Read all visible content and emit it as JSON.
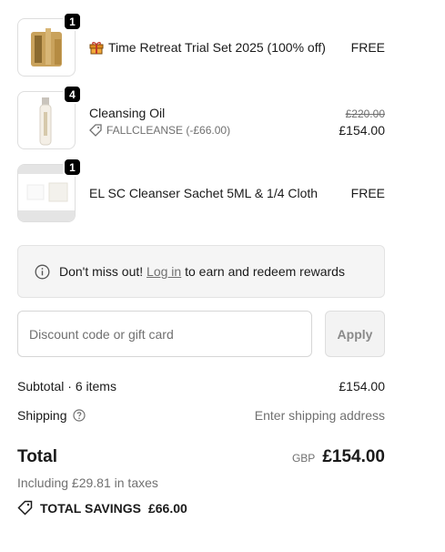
{
  "items": [
    {
      "qty": "1",
      "title": "Time Retreat Trial Set 2025 (100% off)",
      "price": "FREE",
      "icon": "gift-icon"
    },
    {
      "qty": "4",
      "title": "Cleansing Oil",
      "discount_code": "FALLCLEANSE (-£66.00)",
      "original_price": "£220.00",
      "price": "£154.00"
    },
    {
      "qty": "1",
      "title": "EL SC Cleanser Sachet 5ML & 1/4 Cloth",
      "price": "FREE"
    }
  ],
  "notice": {
    "prefix": "Don't miss out! ",
    "link": "Log in",
    "suffix": " to earn and redeem rewards"
  },
  "discount": {
    "placeholder": "Discount code or gift card",
    "apply_label": "Apply"
  },
  "summary": {
    "subtotal_label": "Subtotal · 6 items",
    "subtotal_value": "£154.00",
    "shipping_label": "Shipping",
    "shipping_value": "Enter shipping address",
    "total_label": "Total",
    "currency": "GBP",
    "total_value": "£154.00",
    "taxes": "Including £29.81 in taxes",
    "savings_label": "TOTAL SAVINGS",
    "savings_value": "£66.00"
  },
  "colors": {
    "muted": "#707070",
    "badge": "#000000",
    "gift": "#e08a1e"
  }
}
